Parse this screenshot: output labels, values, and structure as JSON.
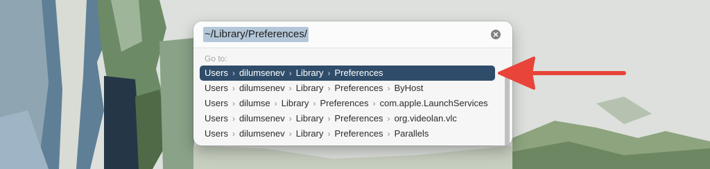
{
  "dialog": {
    "path_value": "~/Library/Preferences/",
    "goto_label": "Go to:",
    "clear_icon": "clear-circle-x-icon"
  },
  "results": [
    {
      "segments": [
        "Users",
        "dilumsenev",
        "Library",
        "Preferences"
      ],
      "selected": true
    },
    {
      "segments": [
        "Users",
        "dilumsenev",
        "Library",
        "Preferences",
        "ByHost"
      ],
      "selected": false
    },
    {
      "segments": [
        "Users",
        "dilumse",
        "Library",
        "Preferences",
        "com.apple.LaunchServices"
      ],
      "selected": false
    },
    {
      "segments": [
        "Users",
        "dilumsenev",
        "Library",
        "Preferences",
        "org.videolan.vlc"
      ],
      "selected": false
    },
    {
      "segments": [
        "Users",
        "dilumsenev",
        "Library",
        "Preferences",
        "Parallels"
      ],
      "selected": false
    }
  ],
  "separator_icon": "chevron-right-icon",
  "annotation": {
    "icon": "red-arrow-icon",
    "color": "#e8443a"
  },
  "colors": {
    "selection": "#2f4d6a",
    "path_highlight": "#b4c7d8"
  }
}
